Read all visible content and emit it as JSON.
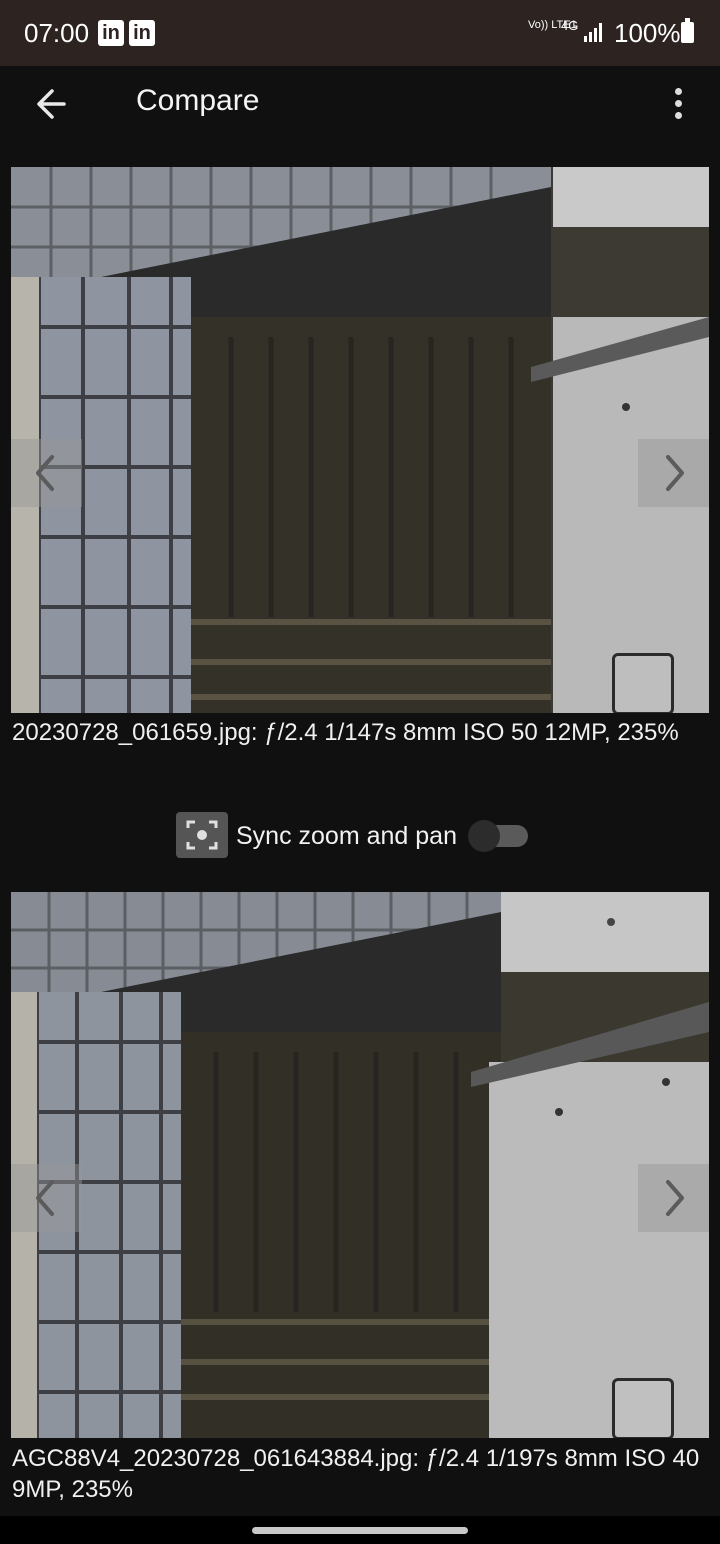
{
  "status_bar": {
    "time": "07:00",
    "notification_icons": [
      "linkedin-icon",
      "linkedin-icon"
    ],
    "linkedin_label": "in",
    "volte_label": "Vo)) LTE1",
    "network": "4G",
    "battery": "100%"
  },
  "app_bar": {
    "title": "Compare",
    "back_icon": "arrow-left-icon",
    "menu_icon": "more-vert-icon"
  },
  "top_image": {
    "caption": "20230728_061659.jpg: ƒ/2.4 1/147s 8mm ISO 50 12MP, 235%"
  },
  "sync": {
    "label": "Sync zoom and pan",
    "enabled": false,
    "icon": "focus-frame-icon"
  },
  "bottom_image": {
    "caption": "AGC88V4_20230728_061643884.jpg: ƒ/2.4 1/197s 8mm ISO 40 9MP, 235%"
  }
}
